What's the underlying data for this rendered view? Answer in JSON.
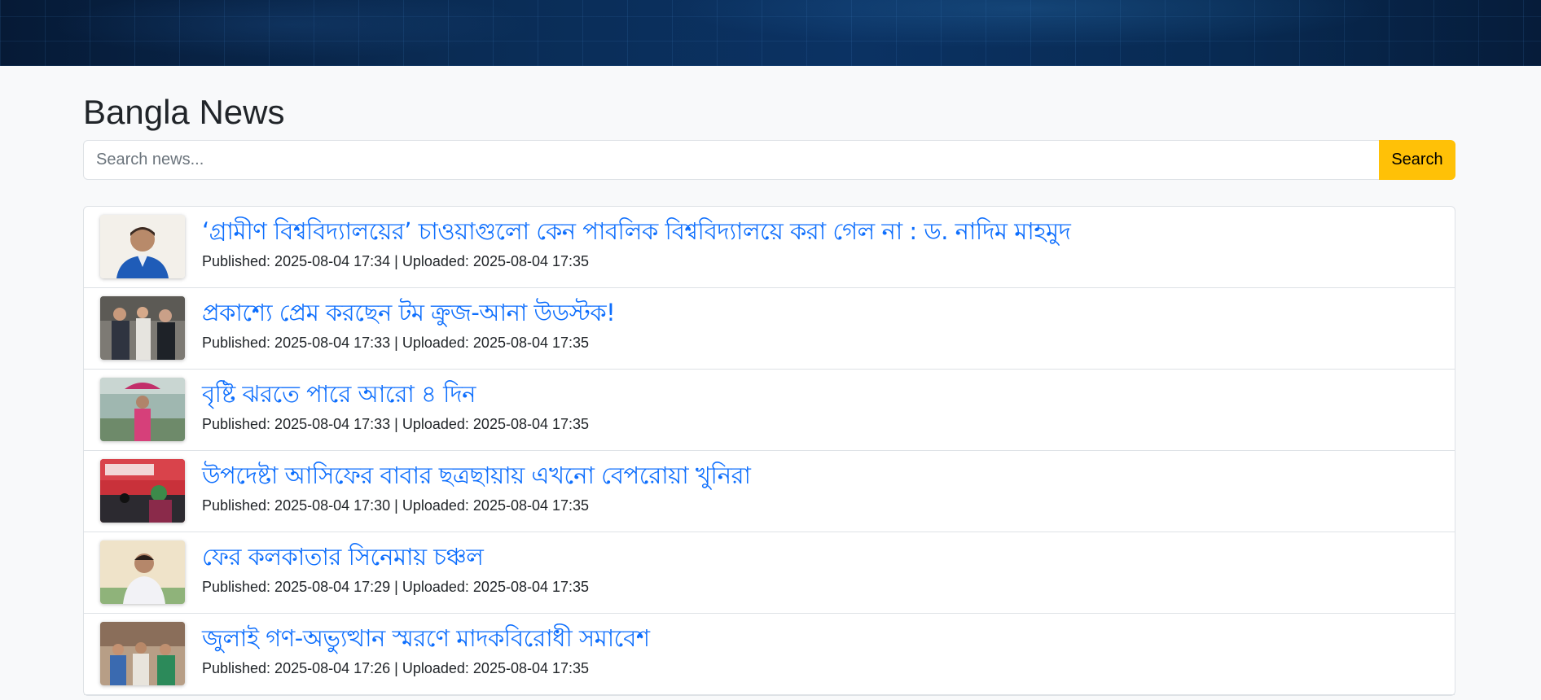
{
  "page": {
    "title": "Bangla News"
  },
  "search": {
    "placeholder": "Search news...",
    "button_label": "Search"
  },
  "news": [
    {
      "title": "‘গ্রামীণ বিশ্ববিদ্যালয়ের’ চাওয়াগুলো কেন পাবলিক বিশ্ববিদ্যালয়ে করা গেল না : ড. নাদিম মাহমুদ",
      "meta": "Published: 2025-08-04 17:34 | Uploaded: 2025-08-04 17:35"
    },
    {
      "title": "প্রকাশ্যে প্রেম করছেন টম ক্রুজ-আনা উডস্টক!",
      "meta": "Published: 2025-08-04 17:33 | Uploaded: 2025-08-04 17:35"
    },
    {
      "title": "বৃষ্টি ঝরতে পারে আরো ৪ দিন",
      "meta": "Published: 2025-08-04 17:33 | Uploaded: 2025-08-04 17:35"
    },
    {
      "title": "উপদেষ্টা আসিফের বাবার ছত্রছায়ায় এখনো বেপরোয়া খুনিরা",
      "meta": "Published: 2025-08-04 17:30 | Uploaded: 2025-08-04 17:35"
    },
    {
      "title": "ফের কলকাতার সিনেমায় চঞ্চল",
      "meta": "Published: 2025-08-04 17:29 | Uploaded: 2025-08-04 17:35"
    },
    {
      "title": "জুলাই গণ-অভ্যুত্থান স্মরণে মাদকবিরোধী সমাবেশ",
      "meta": "Published: 2025-08-04 17:26 | Uploaded: 2025-08-04 17:35"
    }
  ],
  "colors": {
    "link": "#0d6efd",
    "accent": "#ffc107"
  }
}
